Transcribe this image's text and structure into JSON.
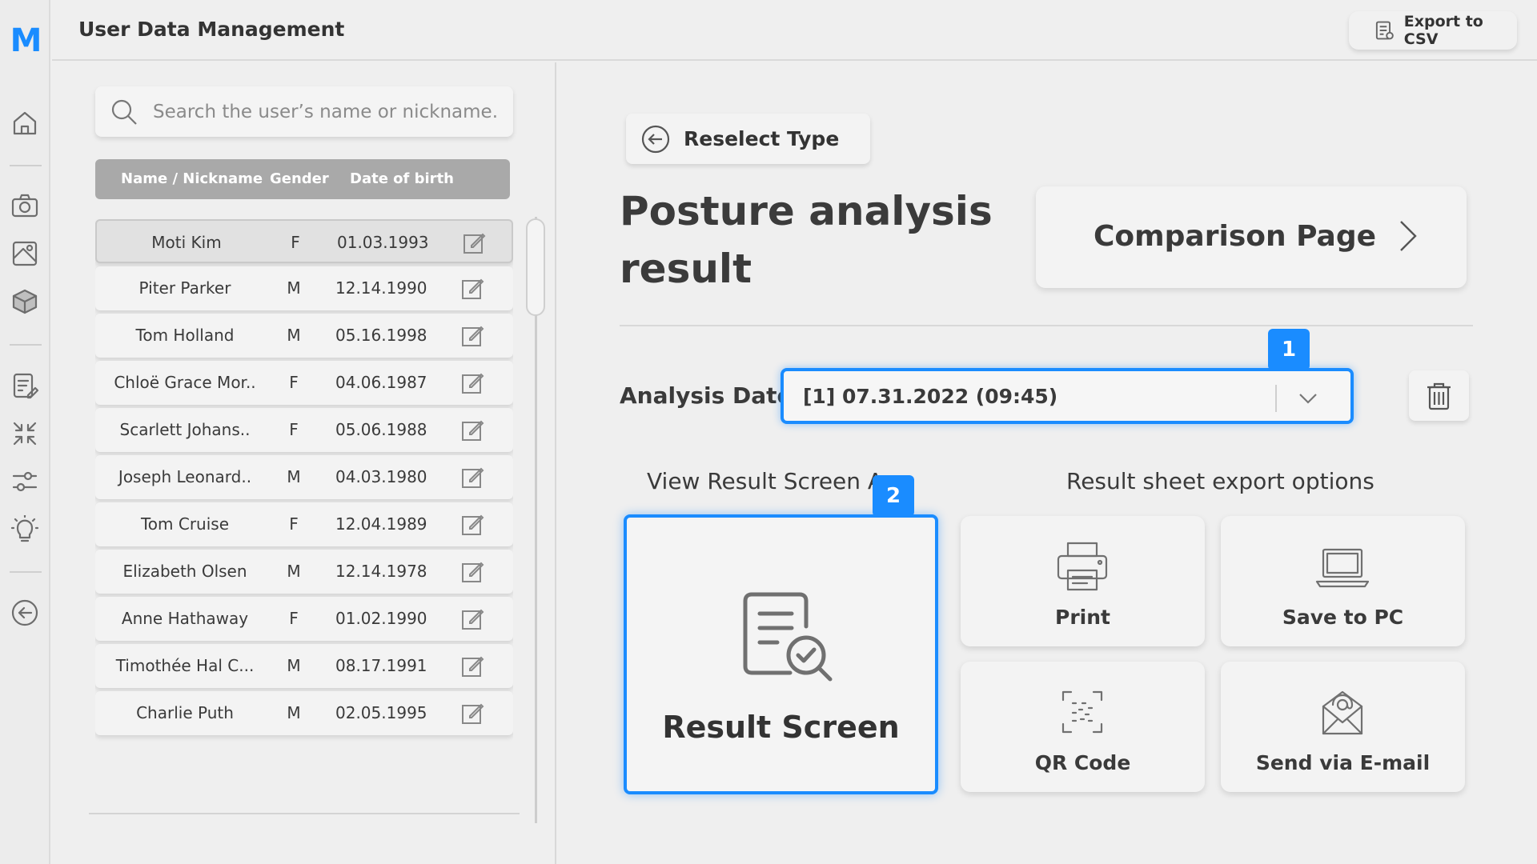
{
  "app": {
    "logo": "M",
    "title": "User Data Management",
    "export_label": "Export to CSV"
  },
  "search": {
    "placeholder": "Search the user’s name or nickname."
  },
  "table": {
    "columns": [
      "Name / Nickname",
      "Gender",
      "Date of birth"
    ],
    "rows": [
      {
        "name": "Moti Kim",
        "gender": "F",
        "dob": "01.03.1993",
        "selected": true
      },
      {
        "name": "Piter Parker",
        "gender": "M",
        "dob": "12.14.1990"
      },
      {
        "name": "Tom Holland",
        "gender": "M",
        "dob": "05.16.1998"
      },
      {
        "name": "Chloë Grace Mor..",
        "gender": "F",
        "dob": "04.06.1987"
      },
      {
        "name": "Scarlett Johans..",
        "gender": "F",
        "dob": "05.06.1988"
      },
      {
        "name": "Joseph Leonard..",
        "gender": "M",
        "dob": "04.03.1980"
      },
      {
        "name": "Tom Cruise",
        "gender": "F",
        "dob": "12.04.1989"
      },
      {
        "name": "Elizabeth Olsen",
        "gender": "M",
        "dob": "12.14.1978"
      },
      {
        "name": "Anne Hathaway",
        "gender": "F",
        "dob": "01.02.1990"
      },
      {
        "name": "Timothée Hal C...",
        "gender": "M",
        "dob": "08.17.1991"
      },
      {
        "name": "Charlie Puth",
        "gender": "M",
        "dob": "02.05.1995"
      }
    ]
  },
  "main": {
    "reselect_label": "Reselect Type",
    "title_line1": "Posture analysis",
    "title_line2": "result",
    "comparison_label": "Comparison Page",
    "analysis_date_label": "Analysis Date",
    "analysis_date_value": "[1] 07.31.2022 (09:45)",
    "badge_1": "1",
    "badge_2": "2",
    "view_again_label": "View Result Screen Again",
    "export_options_label": "Result sheet export options",
    "result_screen_label": "Result Screen",
    "options": {
      "print": "Print",
      "save_pc": "Save to PC",
      "qr": "QR Code",
      "email": "Send via E-mail"
    }
  },
  "colors": {
    "accent": "#1a8cff",
    "background": "#efefef",
    "table_header": "#a9a9a9"
  },
  "icons": {
    "rail": [
      "home-icon",
      "camera-icon",
      "posture-map-icon",
      "cube-icon",
      "report-edit-icon",
      "compress-icon",
      "sliders-icon",
      "lightbulb-icon",
      "back-arrow-icon"
    ]
  }
}
